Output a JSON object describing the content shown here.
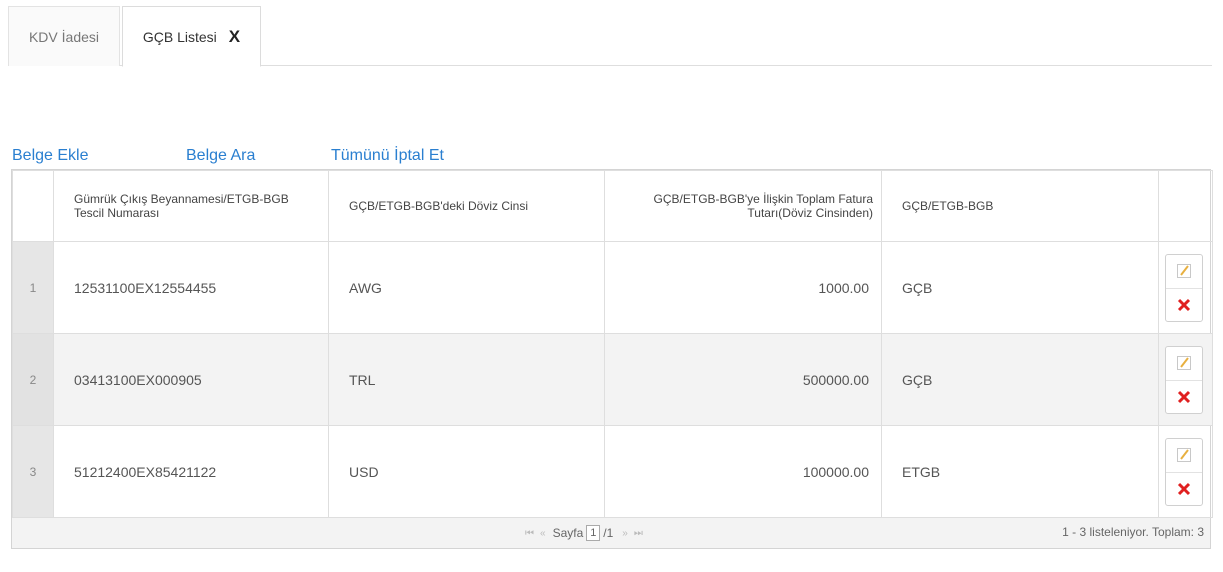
{
  "tabs": [
    {
      "label": "KDV İadesi"
    },
    {
      "label": "GÇB Listesi",
      "close": "X"
    }
  ],
  "links": {
    "add": "Belge Ekle",
    "search": "Belge Ara",
    "cancel_all": "Tümünü İptal Et"
  },
  "table": {
    "columns": [
      "Gümrük Çıkış Beyannamesi/ETGB-BGB Tescil Numarası",
      "GÇB/ETGB-BGB'deki Döviz Cinsi",
      "GÇB/ETGB-BGB'ye İlişkin Toplam Fatura Tutarı(Döviz Cinsinden)",
      "GÇB/ETGB-BGB"
    ],
    "rows": [
      {
        "num": "1",
        "tescil": "12531100EX12554455",
        "doviz": "AWG",
        "tutar": "1000.00",
        "tur": "GÇB"
      },
      {
        "num": "2",
        "tescil": "03413100EX000905",
        "doviz": "TRL",
        "tutar": "500000.00",
        "tur": "GÇB"
      },
      {
        "num": "3",
        "tescil": "51212400EX85421122",
        "doviz": "USD",
        "tutar": "100000.00",
        "tur": "ETGB"
      }
    ]
  },
  "pager": {
    "first": "⏮",
    "prev": "«",
    "page_label": "Sayfa",
    "page_value": "1",
    "total_pages": "/1",
    "next": "»",
    "last": "⏭",
    "summary": "1 - 3 listeleniyor. Toplam: 3"
  },
  "icons": {
    "edit": "edit-icon",
    "delete": "delete-icon"
  },
  "colors": {
    "link": "#2a7fd0",
    "delete": "#e02020",
    "edit": "#e8b040"
  }
}
